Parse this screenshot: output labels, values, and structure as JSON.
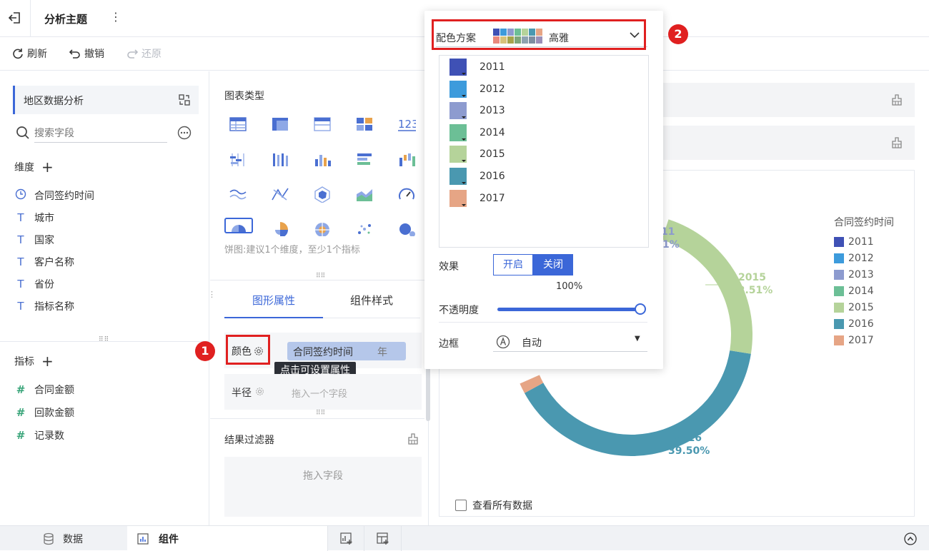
{
  "topbar": {
    "title": "分析主题",
    "more_icon": "⋮"
  },
  "toolbar": {
    "refresh": "刷新",
    "undo": "撤销",
    "redo": "还原"
  },
  "left": {
    "dataset": "地区数据分析",
    "search_placeholder": "搜索字段",
    "dimension_label": "维度",
    "dimensions": [
      {
        "icon": "clock-icon",
        "label": "合同签约时间"
      },
      {
        "icon": "text-field-icon",
        "label": "城市"
      },
      {
        "icon": "text-field-icon",
        "label": "国家"
      },
      {
        "icon": "text-field-icon",
        "label": "客户名称"
      },
      {
        "icon": "text-field-icon",
        "label": "省份"
      },
      {
        "icon": "text-field-icon",
        "label": "指标名称"
      }
    ],
    "measure_label": "指标",
    "measures": [
      {
        "icon": "number-field-icon",
        "label": "合同金额"
      },
      {
        "icon": "number-field-icon",
        "label": "回款金额"
      },
      {
        "icon": "number-field-icon",
        "label": "记录数"
      }
    ]
  },
  "mid": {
    "chart_type_title": "图表类型",
    "pie_hint": "饼图:建议1个维度，至少1个指标",
    "tab_graph": "图形属性",
    "tab_style": "组件样式",
    "color_label": "颜色",
    "color_field": "合同签约时间",
    "color_field_unit": "年",
    "tooltip": "点击可设置属性",
    "radius_label": "半径",
    "radius_placeholder": "拖入一个字段",
    "filter_title": "结果过滤器",
    "filter_placeholder": "拖入字段"
  },
  "popup": {
    "scheme_label": "配色方案",
    "scheme_name": "高雅",
    "scheme_colors": [
      "#3f51b5",
      "#3d9bdc",
      "#8d9bcf",
      "#6cbf96",
      "#b5d39a",
      "#4a98b0",
      "#e6a585",
      "#e9897d",
      "#d7c27a",
      "#a6a34b",
      "#7fa77a",
      "#8ea3b0",
      "#7d8da1",
      "#9a8fb8"
    ],
    "years": [
      {
        "year": "2011",
        "color": "#3f51b5"
      },
      {
        "year": "2012",
        "color": "#3d9bdc"
      },
      {
        "year": "2013",
        "color": "#8d9bcf"
      },
      {
        "year": "2014",
        "color": "#6cbf96"
      },
      {
        "year": "2015",
        "color": "#b5d39a"
      },
      {
        "year": "2016",
        "color": "#4a98b0"
      },
      {
        "year": "2017",
        "color": "#e6a585"
      }
    ],
    "effect_label": "效果",
    "effect_on": "开启",
    "effect_off": "关闭",
    "opacity_value": "100%",
    "opacity_label": "不透明度",
    "opacity_fraction": 1.0,
    "border_label": "边框",
    "border_value": "自动"
  },
  "right": {
    "legend_title": "合同签约时间",
    "view_all": "查看所有数据",
    "label_2011_year": "11",
    "label_2011_pct": "1%",
    "label_2015_year": "2015",
    "label_2015_pct": "22.51%",
    "label_2016_year": "2016",
    "label_2016_pct": "39.50%"
  },
  "chart_data": {
    "type": "pie",
    "categories": [
      "2011",
      "2012",
      "2013",
      "2014",
      "2015",
      "2016",
      "2017"
    ],
    "values": [
      null,
      null,
      null,
      null,
      22.51,
      39.5,
      null
    ],
    "title": "",
    "legend": "right"
  },
  "bottom": {
    "data_tab": "数据",
    "component_tab": "组件"
  },
  "badges": {
    "one": "1",
    "two": "2"
  }
}
